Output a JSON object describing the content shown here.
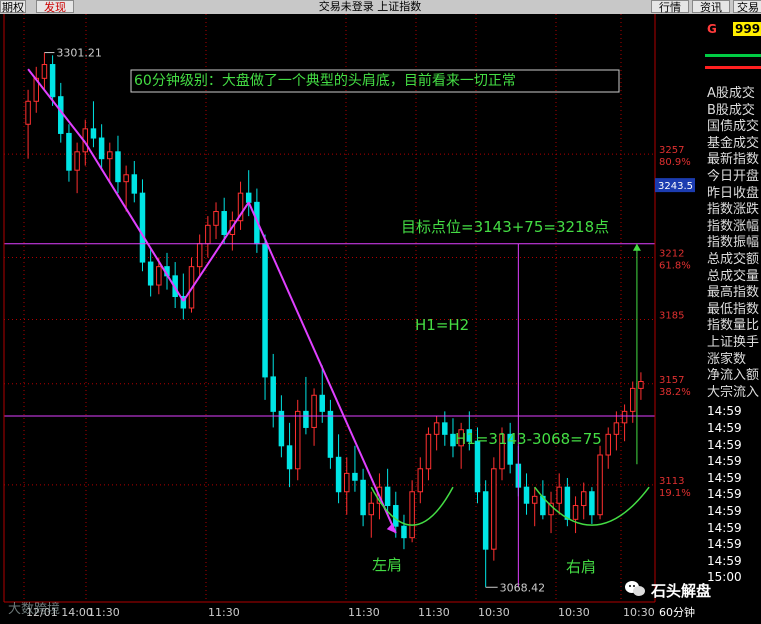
{
  "window": {
    "title": "交易未登录  上证指数",
    "left_buttons": [
      "期权",
      "发现"
    ],
    "right_buttons": [
      "行情",
      "资讯",
      "交易"
    ]
  },
  "right_panel": {
    "badge": "G",
    "code": "999",
    "labels": [
      "A股成交",
      "B股成交",
      "国债成交",
      "基金成交",
      "最新指数",
      "今日开盘",
      "昨日收盘",
      "指数涨跌",
      "指数涨幅",
      "指数振幅",
      "总成交额",
      "总成交量",
      "最高指数",
      "最低指数",
      "指数量比",
      "上证换手",
      "涨家数",
      "净流入额",
      "大宗流入"
    ],
    "times": [
      "14:59",
      "14:59",
      "14:59",
      "14:59",
      "14:59",
      "14:59",
      "14:59",
      "14:59",
      "14:59",
      "14:59",
      "15:00"
    ]
  },
  "watermark": "石头解盘",
  "watermark2": "大数跨境",
  "chart_data": {
    "type": "candlestick",
    "title": "60分钟级别：大盘做了一个典型的头肩底，目前看来一切正常",
    "period": "60分钟",
    "y_ticks": [
      {
        "value": 3257,
        "label": "3257",
        "pct": "80.9%"
      },
      {
        "value": 3212,
        "label": "3212",
        "pct": "61.8%"
      },
      {
        "value": 3185,
        "label": "3185",
        "pct": ""
      },
      {
        "value": 3157,
        "label": "3157",
        "pct": "38.2%"
      },
      {
        "value": 3113,
        "label": "3113",
        "pct": "19.1%"
      }
    ],
    "current_price_tag": "3243.5",
    "x_ticks": [
      "12/01 14:00",
      "11:30",
      "11:30",
      "11:30",
      "11:30",
      "10:30",
      "10:30",
      "10:30"
    ],
    "ylim": [
      3062,
      3318
    ],
    "high_label": "3301.21",
    "low_label": "3068.42",
    "annotations": {
      "target": "目标点位=3143+75=3218点",
      "h_equal": "H1=H2",
      "h_calc": "H1=3143-3068=75",
      "left_shoulder": "左肩",
      "right_shoulder": "右肩"
    },
    "colors": {
      "up": "#ff3030",
      "down": "#00e5e5",
      "trend": "#e040ff",
      "annotation": "#44dd44",
      "grid": "#b00000"
    },
    "candles": [
      [
        3270,
        3285,
        3255,
        3280
      ],
      [
        3280,
        3295,
        3275,
        3290
      ],
      [
        3290,
        3301.21,
        3285,
        3296
      ],
      [
        3296,
        3300,
        3278,
        3282
      ],
      [
        3282,
        3288,
        3262,
        3266
      ],
      [
        3266,
        3270,
        3245,
        3250
      ],
      [
        3250,
        3262,
        3240,
        3258
      ],
      [
        3258,
        3272,
        3252,
        3268
      ],
      [
        3268,
        3280,
        3260,
        3264
      ],
      [
        3264,
        3270,
        3250,
        3255
      ],
      [
        3255,
        3262,
        3245,
        3258
      ],
      [
        3258,
        3265,
        3240,
        3245
      ],
      [
        3245,
        3252,
        3232,
        3248
      ],
      [
        3248,
        3254,
        3236,
        3240
      ],
      [
        3240,
        3246,
        3206,
        3210
      ],
      [
        3210,
        3216,
        3195,
        3200
      ],
      [
        3200,
        3212,
        3196,
        3208
      ],
      [
        3208,
        3214,
        3198,
        3204
      ],
      [
        3204,
        3210,
        3190,
        3195
      ],
      [
        3195,
        3205,
        3185,
        3190
      ],
      [
        3190,
        3212,
        3188,
        3208
      ],
      [
        3208,
        3222,
        3204,
        3218
      ],
      [
        3218,
        3230,
        3212,
        3226
      ],
      [
        3226,
        3236,
        3220,
        3232
      ],
      [
        3232,
        3238,
        3218,
        3222
      ],
      [
        3222,
        3232,
        3215,
        3228
      ],
      [
        3228,
        3245,
        3224,
        3240
      ],
      [
        3240,
        3250,
        3230,
        3236
      ],
      [
        3236,
        3242,
        3214,
        3218
      ],
      [
        3218,
        3222,
        3150,
        3160
      ],
      [
        3160,
        3170,
        3138,
        3145
      ],
      [
        3145,
        3152,
        3125,
        3130
      ],
      [
        3130,
        3140,
        3112,
        3120
      ],
      [
        3120,
        3150,
        3115,
        3145
      ],
      [
        3145,
        3160,
        3135,
        3138
      ],
      [
        3138,
        3155,
        3130,
        3152
      ],
      [
        3152,
        3165,
        3140,
        3145
      ],
      [
        3145,
        3150,
        3120,
        3125
      ],
      [
        3125,
        3135,
        3105,
        3110
      ],
      [
        3110,
        3125,
        3100,
        3118
      ],
      [
        3118,
        3130,
        3110,
        3115
      ],
      [
        3115,
        3120,
        3095,
        3100
      ],
      [
        3100,
        3110,
        3090,
        3105
      ],
      [
        3105,
        3118,
        3098,
        3112
      ],
      [
        3112,
        3120,
        3100,
        3104
      ],
      [
        3104,
        3110,
        3090,
        3095
      ],
      [
        3095,
        3100,
        3085,
        3090
      ],
      [
        3090,
        3115,
        3088,
        3110
      ],
      [
        3110,
        3125,
        3105,
        3120
      ],
      [
        3120,
        3138,
        3115,
        3135
      ],
      [
        3135,
        3143,
        3128,
        3140
      ],
      [
        3140,
        3145,
        3130,
        3135
      ],
      [
        3135,
        3142,
        3125,
        3130
      ],
      [
        3130,
        3140,
        3120,
        3137
      ],
      [
        3137,
        3145,
        3128,
        3132
      ],
      [
        3132,
        3138,
        3105,
        3110
      ],
      [
        3110,
        3115,
        3068.42,
        3085
      ],
      [
        3085,
        3125,
        3080,
        3120
      ],
      [
        3120,
        3138,
        3115,
        3135
      ],
      [
        3135,
        3140,
        3118,
        3122
      ],
      [
        3122,
        3130,
        3108,
        3112
      ],
      [
        3112,
        3118,
        3100,
        3105
      ],
      [
        3105,
        3112,
        3095,
        3108
      ],
      [
        3108,
        3115,
        3098,
        3100
      ],
      [
        3100,
        3110,
        3092,
        3105
      ],
      [
        3105,
        3118,
        3100,
        3112
      ],
      [
        3112,
        3116,
        3095,
        3098
      ],
      [
        3098,
        3108,
        3092,
        3104
      ],
      [
        3104,
        3114,
        3098,
        3110
      ],
      [
        3110,
        3112,
        3096,
        3100
      ],
      [
        3100,
        3130,
        3098,
        3126
      ],
      [
        3126,
        3138,
        3120,
        3135
      ],
      [
        3135,
        3145,
        3128,
        3140
      ],
      [
        3140,
        3148,
        3132,
        3145
      ],
      [
        3145,
        3158,
        3140,
        3155
      ],
      [
        3155,
        3162,
        3150,
        3158
      ]
    ],
    "trend_lines": [
      [
        [
          0,
          3294
        ],
        [
          7,
          3262
        ]
      ],
      [
        [
          7,
          3262
        ],
        [
          19,
          3193
        ]
      ],
      [
        [
          19,
          3193
        ],
        [
          27,
          3236
        ]
      ],
      [
        [
          27,
          3236
        ],
        [
          45,
          3092
        ]
      ]
    ]
  }
}
